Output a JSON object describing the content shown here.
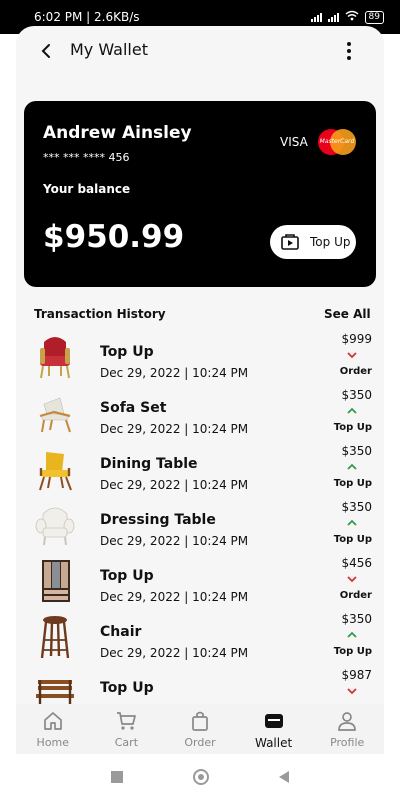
{
  "status_bar": {
    "left_text": "6:02 PM | 2.6KB/s",
    "battery": "89"
  },
  "header": {
    "title": "My Wallet"
  },
  "card": {
    "name": "Andrew Ainsley",
    "number": "*** *** **** 456",
    "visa": "VISA",
    "mastercard": "MasterCard",
    "balance_label": "Your balance",
    "balance": "$950.99",
    "topup_label": "Top Up"
  },
  "transactions": {
    "title": "Transaction History",
    "see_all": "See All",
    "items": [
      {
        "title": "Top Up",
        "date": "Dec 29, 2022 | 10:24 PM",
        "amount": "$999",
        "type": "Order",
        "direction": "down",
        "icon": "armchair-red-icon"
      },
      {
        "title": "Sofa Set",
        "date": "Dec 29, 2022 | 10:24 PM",
        "amount": "$350",
        "type": "Top Up",
        "direction": "up",
        "icon": "lounge-chair-icon"
      },
      {
        "title": "Dining Table",
        "date": "Dec 29, 2022 | 10:24 PM",
        "amount": "$350",
        "type": "Top Up",
        "direction": "up",
        "icon": "yellow-chair-icon"
      },
      {
        "title": "Dressing Table",
        "date": "Dec 29, 2022 | 10:24 PM",
        "amount": "$350",
        "type": "Top Up",
        "direction": "up",
        "icon": "white-armchair-icon"
      },
      {
        "title": "Top Up",
        "date": "Dec 29, 2022 | 10:24 PM",
        "amount": "$456",
        "type": "Order",
        "direction": "down",
        "icon": "wardrobe-icon"
      },
      {
        "title": "Chair",
        "date": "Dec 29, 2022 | 10:24 PM",
        "amount": "$350",
        "type": "Top Up",
        "direction": "up",
        "icon": "stool-icon"
      },
      {
        "title": "Top Up",
        "date": "",
        "amount": "$987",
        "type": "",
        "direction": "down",
        "icon": "bench-icon"
      }
    ]
  },
  "nav": [
    {
      "label": "Home",
      "icon": "home-icon"
    },
    {
      "label": "Cart",
      "icon": "cart-icon"
    },
    {
      "label": "Order",
      "icon": "bag-icon"
    },
    {
      "label": "Wallet",
      "icon": "wallet-icon",
      "active": true
    },
    {
      "label": "Profile",
      "icon": "profile-icon"
    }
  ],
  "colors": {
    "up_arrow": "#2e9e4a",
    "down_arrow": "#d7332d",
    "card_bg": "#000000"
  }
}
